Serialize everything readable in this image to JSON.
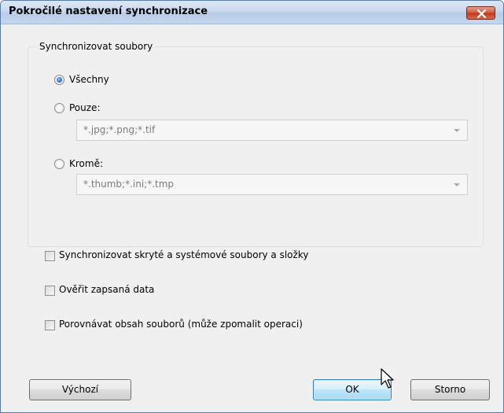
{
  "dialog": {
    "title": "Pokročilé nastavení synchronizace"
  },
  "sync_group": {
    "legend": "Synchronizovat soubory",
    "options": [
      {
        "label": "Všechny",
        "checked": true
      },
      {
        "label": "Pouze:",
        "checked": false,
        "combo_value": "*.jpg;*.png;*.tif"
      },
      {
        "label": "Kromě:",
        "checked": false,
        "combo_value": "*.thumb;*.ini;*.tmp"
      }
    ]
  },
  "checkboxes": [
    {
      "label": "Synchronizovat skryté a systémové soubory a složky",
      "checked": false
    },
    {
      "label": "Ověřit zapsaná data",
      "checked": false
    },
    {
      "label": "Porovnávat obsah souborů (může zpomalit operaci)",
      "checked": false
    }
  ],
  "buttons": {
    "default_label": "Výchozí",
    "ok_label": "OK",
    "cancel_label": "Storno"
  }
}
